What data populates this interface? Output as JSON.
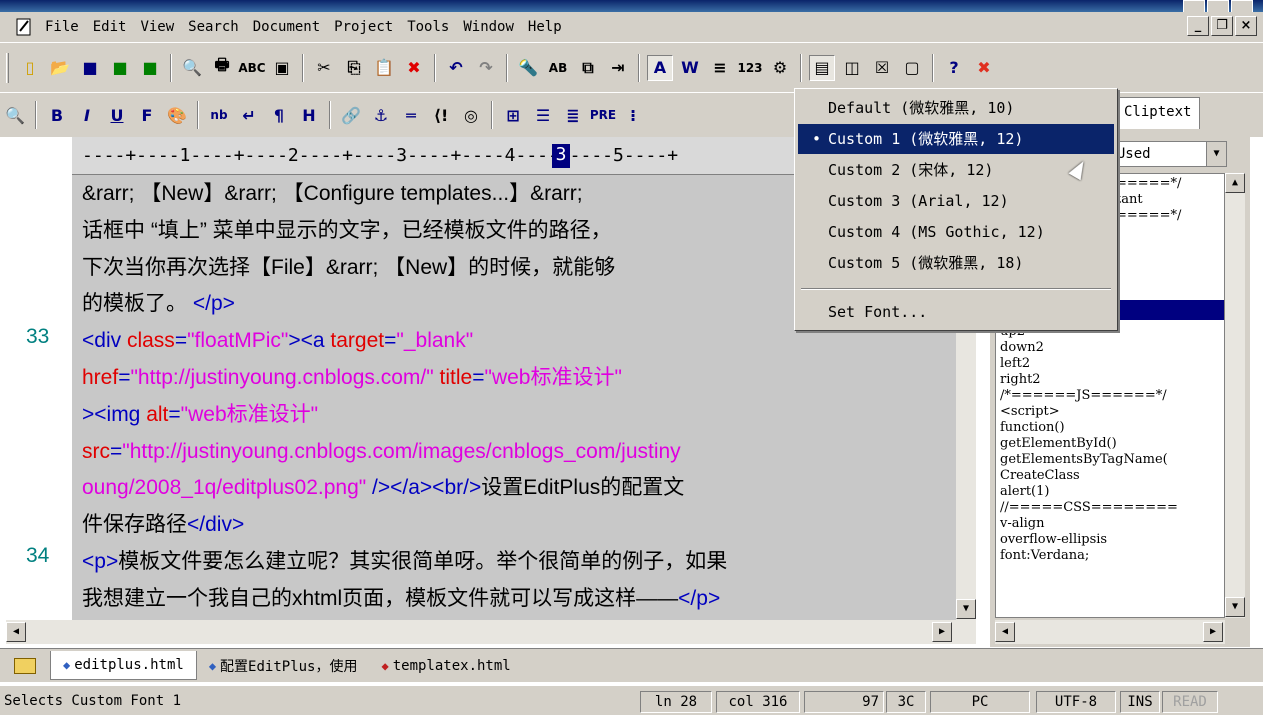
{
  "menubar": {
    "items": [
      "File",
      "Edit",
      "View",
      "Search",
      "Document",
      "Project",
      "Tools",
      "Window",
      "Help"
    ]
  },
  "toolbar1": {
    "buttons": [
      "new-file",
      "open",
      "save",
      "save-all",
      "close",
      "print-preview",
      "print",
      "spell-check",
      "html-toolbar",
      "cut",
      "copy",
      "paste",
      "delete",
      "undo",
      "redo",
      "find",
      "replace",
      "duplicate",
      "indent",
      "font",
      "word-wrap",
      "line-number",
      "column-ruler",
      "preferences",
      "view-1",
      "view-2",
      "view-3",
      "view-4",
      "help",
      "close-red"
    ]
  },
  "toolbar2": {
    "buttons": [
      "B",
      "I",
      "U",
      "F",
      "nb",
      "↵",
      "¶",
      "H",
      "PRE"
    ]
  },
  "right_tab": "Cliptext",
  "ruler": {
    "text": "----+----1----+----2----+----3----+----4----+----5----+",
    "cursor_mark": "3"
  },
  "editor": {
    "line_numbers": [
      "33",
      "34"
    ],
    "lines": [
      {
        "segments": [
          {
            "c": "text",
            "t": "&rarr; 【New】&rarr; 【Configure templates...】&rarr; "
          }
        ]
      },
      {
        "segments": [
          {
            "c": "text",
            "t": "话框中 “填上” 菜单中显示的文字，已经模板文件的路径，"
          }
        ]
      },
      {
        "segments": [
          {
            "c": "text",
            "t": "下次当你再次选择【File】&rarr; 【New】的时候，就能够"
          }
        ]
      },
      {
        "segments": [
          {
            "c": "text",
            "t": "的模板了。 "
          },
          {
            "c": "tag",
            "t": "</p>"
          }
        ]
      },
      {
        "segments": [
          {
            "c": "tag",
            "t": "<div "
          },
          {
            "c": "attr",
            "t": "class"
          },
          {
            "c": "tag",
            "t": "="
          },
          {
            "c": "val",
            "t": "\"floatMPic\""
          },
          {
            "c": "tag",
            "t": "><a "
          },
          {
            "c": "attr",
            "t": "target"
          },
          {
            "c": "tag",
            "t": "="
          },
          {
            "c": "val",
            "t": "\"_blank\""
          }
        ]
      },
      {
        "segments": [
          {
            "c": "attr",
            "t": "href"
          },
          {
            "c": "tag",
            "t": "="
          },
          {
            "c": "val",
            "t": "\"http://justinyoung.cnblogs.com/\" "
          },
          {
            "c": "attr",
            "t": "title"
          },
          {
            "c": "tag",
            "t": "="
          },
          {
            "c": "val",
            "t": "\"web标准设计\""
          }
        ]
      },
      {
        "segments": [
          {
            "c": "tag",
            "t": "><img "
          },
          {
            "c": "attr",
            "t": "alt"
          },
          {
            "c": "tag",
            "t": "="
          },
          {
            "c": "val",
            "t": "\"web标准设计\""
          }
        ]
      },
      {
        "segments": [
          {
            "c": "attr",
            "t": "src"
          },
          {
            "c": "tag",
            "t": "="
          },
          {
            "c": "val",
            "t": "\"http://justinyoung.cnblogs.com/images/cnblogs_com/justiny"
          }
        ]
      },
      {
        "segments": [
          {
            "c": "val",
            "t": "oung/2008_1q/editplus02.png\" "
          },
          {
            "c": "tag",
            "t": "/></a><br/>"
          },
          {
            "c": "text",
            "t": "设置EditPlus的配置文"
          }
        ]
      },
      {
        "segments": [
          {
            "c": "text",
            "t": "件保存路径"
          },
          {
            "c": "tag",
            "t": "</div>"
          }
        ]
      },
      {
        "segments": [
          {
            "c": "tag",
            "t": "<p>"
          },
          {
            "c": "text",
            "t": "模板文件要怎么建立呢？其实很简单呀。举个很简单的例子，如果"
          }
        ]
      },
      {
        "segments": [
          {
            "c": "text",
            "t": "我想建立一个我自己的xhtml页面，模板文件就可以写成这样——"
          },
          {
            "c": "tag",
            "t": "</p>"
          }
        ]
      }
    ]
  },
  "clip_panel": {
    "selected": "lyUsed",
    "items": [
      "=====*/",
      "tant",
      "=====*/",
      "",
      "",
      "",
      "",
      "",
      "up2",
      "down2",
      "left2",
      "right2",
      "/*======JS======*/",
      "<script>",
      "function()",
      "getElementById()",
      "getElementsByTagName(",
      "CreateClass",
      "alert(1)",
      "//=====CSS========",
      "v-align",
      "overflow-ellipsis",
      "font:Verdana;"
    ]
  },
  "doc_tabs": [
    {
      "label": "editplus.html",
      "dot_color": "#3060c0"
    },
    {
      "label": "配置EditPlus，使用",
      "dot_color": "#3060c0"
    },
    {
      "label": "templatex.html",
      "dot_color": "#c02020"
    }
  ],
  "status": {
    "message": "Selects Custom Font 1",
    "ln": "ln 28",
    "col": "col 316",
    "v1": "97",
    "v2": "3C",
    "mode": "PC",
    "encoding": "UTF-8",
    "ins": "INS",
    "read": "READ"
  },
  "font_menu": {
    "items": [
      {
        "label": "Default (微软雅黑, 10)",
        "selected": false
      },
      {
        "label": "Custom 1 (微软雅黑, 12)",
        "selected": true
      },
      {
        "label": "Custom 2 (宋体, 12)",
        "selected": false
      },
      {
        "label": "Custom 3 (Arial, 12)",
        "selected": false
      },
      {
        "label": "Custom 4 (MS Gothic, 12)",
        "selected": false
      },
      {
        "label": "Custom 5 (微软雅黑, 18)",
        "selected": false
      }
    ],
    "set_font": "Set Font..."
  }
}
